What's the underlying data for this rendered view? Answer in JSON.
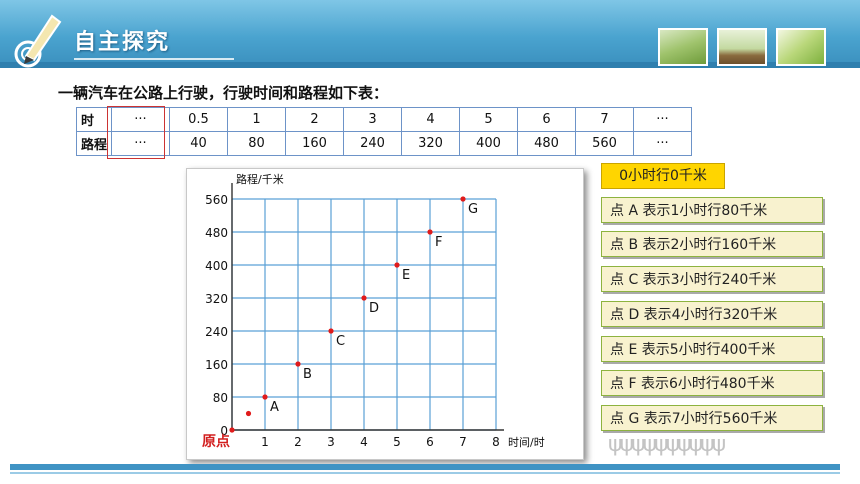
{
  "header": {
    "title": "自主探究"
  },
  "intro": "一辆汽车在公路上行驶，行驶时间和路程如下表：",
  "table": {
    "row1": {
      "head": "时",
      "cells": [
        "···",
        "0.5",
        "1",
        "2",
        "3",
        "4",
        "5",
        "6",
        "7",
        "···"
      ]
    },
    "row2": {
      "head": "路程",
      "cells": [
        "···",
        "40",
        "80",
        "160",
        "240",
        "320",
        "400",
        "480",
        "560",
        "···"
      ]
    }
  },
  "chart_data": {
    "type": "scatter",
    "ylabel": "路程/千米",
    "xlabel": "时间/时",
    "xlim": [
      0,
      8
    ],
    "ylim": [
      0,
      560
    ],
    "x_ticks": [
      "0",
      "1",
      "2",
      "3",
      "4",
      "5",
      "6",
      "7",
      "8"
    ],
    "y_ticks": [
      "0",
      "80",
      "160",
      "240",
      "320",
      "400",
      "480",
      "560"
    ],
    "origin_label": "原点",
    "grid": true,
    "points": [
      {
        "label": "",
        "x": 0,
        "y": 0
      },
      {
        "label": "",
        "x": 0.5,
        "y": 40
      },
      {
        "label": "A",
        "x": 1,
        "y": 80
      },
      {
        "label": "B",
        "x": 2,
        "y": 160
      },
      {
        "label": "C",
        "x": 3,
        "y": 240
      },
      {
        "label": "D",
        "x": 4,
        "y": 320
      },
      {
        "label": "E",
        "x": 5,
        "y": 400
      },
      {
        "label": "F",
        "x": 6,
        "y": 480
      },
      {
        "label": "G",
        "x": 7,
        "y": 560
      }
    ],
    "point_color": "#e01b1b"
  },
  "notes": {
    "zero": "0小时行0千米",
    "items": [
      "点 A 表示1小时行80千米",
      "点 B 表示2小时行160千米",
      "点 C 表示3小时行240千米",
      "点 D 表示4小时行320千米",
      "点 E 表示5小时行400千米",
      "点 F 表示6小时行480千米",
      "点 G 表示7小时行560千米"
    ]
  }
}
